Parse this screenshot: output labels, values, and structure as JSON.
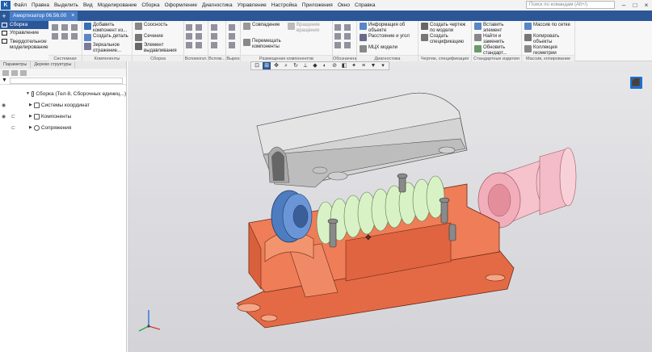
{
  "menu": {
    "logo": "K",
    "items": [
      "Файл",
      "Правка",
      "Выделить",
      "Вид",
      "Моделирование",
      "Сборка",
      "Оформление",
      "Диагностика",
      "Управление",
      "Настройка",
      "Приложения",
      "Окно",
      "Справка"
    ],
    "command_search_placeholder": "Поиск по командам (Alt+/)"
  },
  "tabs": {
    "new": "+",
    "active": {
      "label": "Амортизатор 06.56.00",
      "close": "×"
    }
  },
  "ribbon": {
    "modes": [
      "Сборка",
      "Управление",
      "Твердотельное моделирование"
    ],
    "groups": [
      {
        "label": "Системная",
        "items": [
          "Добавить компонент из...",
          "Создать деталь",
          "Зеркальное отражение..."
        ]
      },
      {
        "label": "Компоненты",
        "items": []
      },
      {
        "label": "Сборка",
        "items": [
          "Соосность",
          "Сечение",
          "Элемент выдавливания"
        ]
      },
      {
        "label": "Вспомогат.",
        "items": []
      },
      {
        "label": "Вспом...",
        "items": []
      },
      {
        "label": "Вырез",
        "items": []
      },
      {
        "label": "Размещение компонентов",
        "items": [
          "Совпадение",
          "Вращение вращения",
          "Перемещать компоненты"
        ]
      },
      {
        "label": "Обозначения",
        "items": []
      },
      {
        "label": "Диагностика",
        "items": [
          "Информация об объекте",
          "Расстояние и угол",
          "МЦХ модели"
        ]
      },
      {
        "label": "Чертеж, спецификация",
        "items": [
          "Создать чертеж по модели",
          "Создать спецификацию"
        ]
      },
      {
        "label": "Стандартные изделия",
        "items": [
          "Вставить элемент",
          "Найти и заменить",
          "Обновить стандарт..."
        ]
      },
      {
        "label": "Массив, копирование",
        "items": [
          "Массив по сетке",
          "Копировать объекты",
          "Коллекция геометрии"
        ]
      }
    ]
  },
  "panel": {
    "tabs": [
      "Параметры",
      "Дерево структуры"
    ],
    "filter_placeholder": "",
    "tree": [
      {
        "label": "Сборка (Тел-8, Сборочных единиц...)",
        "level": 0
      },
      {
        "label": "Системы координат",
        "level": 1
      },
      {
        "label": "Компоненты",
        "level": 1
      },
      {
        "label": "Сопряжения",
        "level": 1
      }
    ]
  },
  "colors": {
    "accent": "#2b5797",
    "housing": "#e4704f",
    "spring": "#d8f0c4",
    "cover": "#c8c8c8",
    "sleeve": "#f4b8c4",
    "disc": "#5a86c8"
  }
}
